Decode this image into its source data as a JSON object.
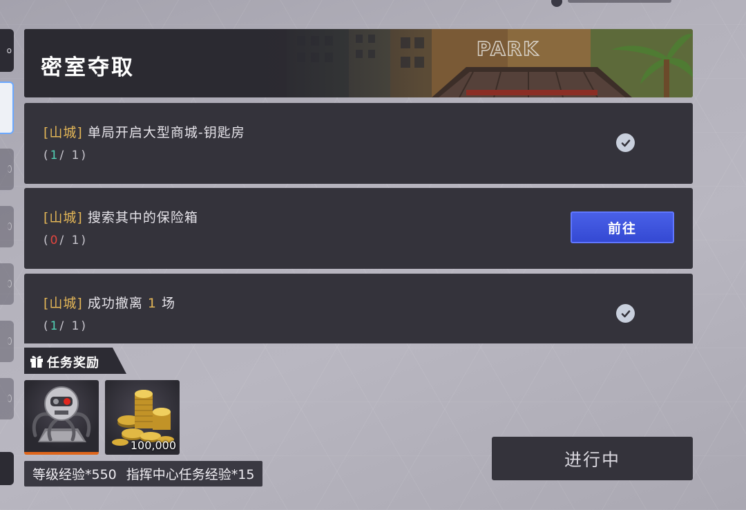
{
  "header": {
    "title": "密室夺取"
  },
  "tasks": [
    {
      "location": "[山城]",
      "text_before": " 单局开启大型商城-钥匙房",
      "highlight": "",
      "text_after": "",
      "progress_open": "(",
      "progress_current": "1",
      "progress_rest": "/ 1)",
      "state": "done",
      "state_icon": "check-icon"
    },
    {
      "location": "[山城]",
      "text_before": " 搜索其中的保险箱",
      "highlight": "",
      "text_after": "",
      "progress_open": "(",
      "progress_current": "0",
      "progress_rest": "/ 1)",
      "state": "todo",
      "action_label": "前往"
    },
    {
      "location": "[山城]",
      "text_before": " 成功撤离 ",
      "highlight": "1",
      "text_after": " 场",
      "progress_open": "(",
      "progress_current": "1",
      "progress_rest": "/ 1)",
      "state": "done",
      "state_icon": "check-icon"
    }
  ],
  "rewards": {
    "label": "任务奖励",
    "label_icon": "gift-icon",
    "items": [
      {
        "icon": "robot-mech-icon",
        "quantity": ""
      },
      {
        "icon": "gold-coins-icon",
        "quantity": "100,000"
      }
    ],
    "exp_level": "等级经验*550",
    "exp_command": "指挥中心任务经验*15"
  },
  "status": {
    "label": "进行中"
  },
  "header_sign": "PARK",
  "colors": {
    "location": "#e3b657",
    "progress_done": "#52d3b6",
    "progress_zero": "#e5463f",
    "action_button": "#3f55de",
    "card_bg": "#34333b"
  }
}
